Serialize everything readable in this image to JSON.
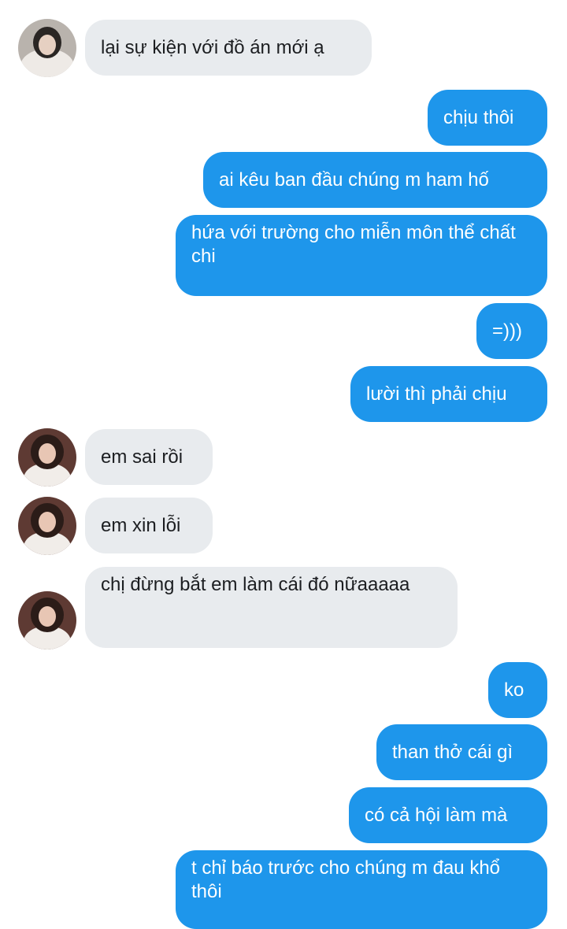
{
  "messages": [
    {
      "from": "them",
      "text": "lại sự kiện với đồ án mới ạ"
    },
    {
      "from": "me",
      "text": "chịu thôi"
    },
    {
      "from": "me",
      "text": "ai kêu ban đầu chúng m ham hố"
    },
    {
      "from": "me",
      "text": "hứa với trường cho miễn môn thể chất chi"
    },
    {
      "from": "me",
      "text": "=)))"
    },
    {
      "from": "me",
      "text": "lười thì phải chịu"
    },
    {
      "from": "them",
      "text": "em sai rồi"
    },
    {
      "from": "them",
      "text": "em xin lỗi"
    },
    {
      "from": "them",
      "text": "chị đừng bắt em làm cái đó nữaaaaa"
    },
    {
      "from": "me",
      "text": "ko"
    },
    {
      "from": "me",
      "text": "than thở cái gì"
    },
    {
      "from": "me",
      "text": "có cả hội làm mà"
    },
    {
      "from": "me",
      "text": "t chỉ báo trước cho chúng m đau khổ thôi"
    }
  ],
  "colors": {
    "incoming_bubble": "#e8ebee",
    "outgoing_bubble": "#1e96eb",
    "incoming_text": "#1c1e21",
    "outgoing_text": "#ffffff"
  },
  "icons": {
    "avatar": "contact-avatar-photo"
  }
}
